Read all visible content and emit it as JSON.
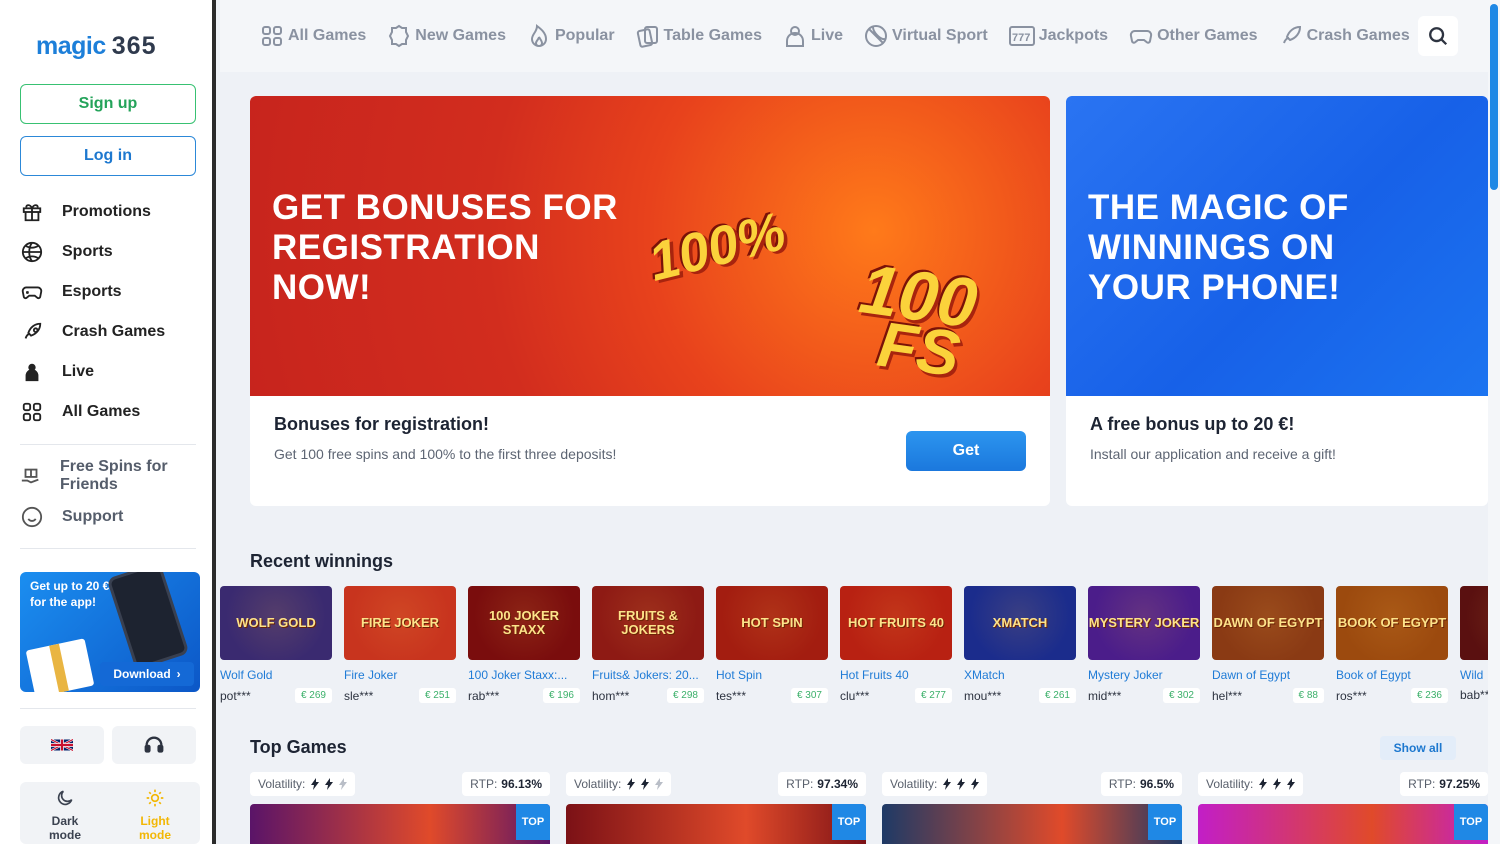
{
  "logo": {
    "text": "magic",
    "num": "365"
  },
  "auth": {
    "signup": "Sign up",
    "login": "Log in"
  },
  "sidebar": {
    "items": [
      {
        "label": "Promotions",
        "icon": "gift-icon"
      },
      {
        "label": "Sports",
        "icon": "ball-icon"
      },
      {
        "label": "Esports",
        "icon": "gamepad-icon"
      },
      {
        "label": "Crash Games",
        "icon": "rocket-icon"
      },
      {
        "label": "Live",
        "icon": "dealer-icon"
      },
      {
        "label": "All Games",
        "icon": "grid-icon"
      }
    ],
    "secondary": [
      {
        "label": "Free Spins for Friends",
        "icon": "gift-hand-icon"
      },
      {
        "label": "Support",
        "icon": "smile-icon"
      }
    ]
  },
  "app_promo": {
    "text": "Get up to 20 € for the app!",
    "download": "Download"
  },
  "theme": {
    "dark": "Dark mode",
    "light": "Light mode"
  },
  "topnav": [
    {
      "label": "All Games",
      "icon": "grid-icon"
    },
    {
      "label": "New Games",
      "icon": "new-badge-icon"
    },
    {
      "label": "Popular",
      "icon": "flame-icon"
    },
    {
      "label": "Table Games",
      "icon": "cards-icon"
    },
    {
      "label": "Live",
      "icon": "dealer-icon"
    },
    {
      "label": "Virtual Sport",
      "icon": "ball-icon"
    },
    {
      "label": "Jackpots",
      "icon": "777-icon"
    },
    {
      "label": "Other Games",
      "icon": "gamepad-icon"
    },
    {
      "label": "Crash Games",
      "icon": "rocket-icon"
    }
  ],
  "banners": [
    {
      "headline": "GET BONUSES FOR REGISTRATION NOW!",
      "title": "Bonuses for registration!",
      "subtitle": "Get 100 free spins and 100% to the first three deposits!",
      "button": "Get",
      "art1": "100%",
      "art2": "100",
      "art3": "FS"
    },
    {
      "headline": "THE MAGIC OF WINNINGS ON YOUR PHONE!",
      "title": "A free bonus up to 20 €!",
      "subtitle": "Install our application and receive a gift!"
    }
  ],
  "recent": {
    "title": "Recent winnings",
    "items": [
      {
        "name": "Wolf Gold",
        "user": "pot***",
        "amount": "€ 269",
        "art": "WOLF GOLD",
        "bg": "#3a2a70"
      },
      {
        "name": "Fire Joker",
        "user": "sle***",
        "amount": "€ 251",
        "art": "FIRE JOKER",
        "bg": "#c8341e"
      },
      {
        "name": "100 Joker Staxx:...",
        "user": "rab***",
        "amount": "€ 196",
        "art": "100 JOKER STAXX",
        "bg": "#7a0d0d"
      },
      {
        "name": "Fruits& Jokers: 20...",
        "user": "hom***",
        "amount": "€ 298",
        "art": "FRUITS & JOKERS",
        "bg": "#8e1a14"
      },
      {
        "name": "Hot Spin",
        "user": "tes***",
        "amount": "€ 307",
        "art": "HOT SPIN",
        "bg": "#a31d10"
      },
      {
        "name": "Hot Fruits 40",
        "user": "clu***",
        "amount": "€ 277",
        "art": "HOT FRUITS 40",
        "bg": "#b82112"
      },
      {
        "name": "XMatch",
        "user": "mou***",
        "amount": "€ 261",
        "art": "XMATCH",
        "bg": "#1b2c8c"
      },
      {
        "name": "Mystery Joker",
        "user": "mid***",
        "amount": "€ 302",
        "art": "MYSTERY JOKER",
        "bg": "#4b1d8a"
      },
      {
        "name": "Dawn of Egypt",
        "user": "hel***",
        "amount": "€ 88",
        "art": "DAWN OF EGYPT",
        "bg": "#8a3a14"
      },
      {
        "name": "Book of Egypt",
        "user": "ros***",
        "amount": "€ 236",
        "art": "BOOK OF EGYPT",
        "bg": "#9c4a0e"
      },
      {
        "name": "Wild",
        "user": "bab***",
        "amount": "",
        "art": "",
        "bg": "#5a1010"
      }
    ]
  },
  "top": {
    "title": "Top Games",
    "show_all": "Show all",
    "volatility_label": "Volatility:",
    "rtp_label": "RTP:",
    "badge": "TOP",
    "items": [
      {
        "rtp": "96.13%",
        "bg": "#5a1468"
      },
      {
        "rtp": "97.34%",
        "bg": "#7b1116"
      },
      {
        "rtp": "96.5%",
        "bg": "#1e3a66"
      },
      {
        "rtp": "97.25%",
        "bg": "#c21ec7"
      }
    ]
  }
}
